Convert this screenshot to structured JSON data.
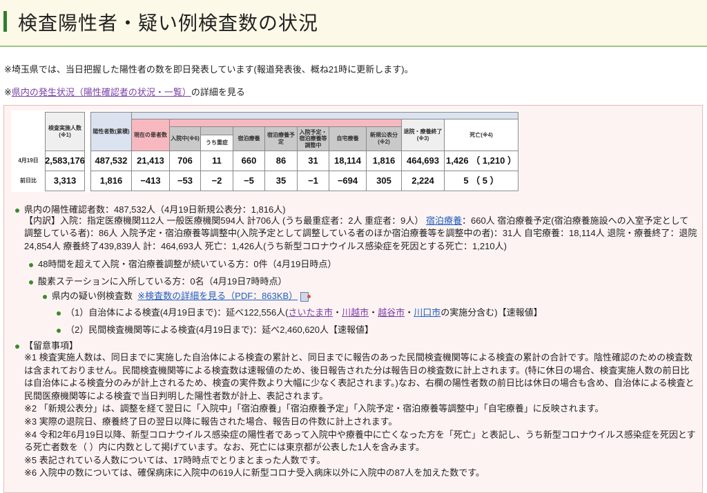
{
  "header": {
    "title": "検査陽性者・疑い例検査数の状況"
  },
  "intro": {
    "notice": "※埼玉県では、当日把握した陽性者の数を即日発表しています(報道発表後、概ね21時に更新します)。",
    "link_prefix": "※",
    "link_text": "県内の発生状況（陽性確認者の状況・一覧）",
    "link_suffix": "の詳細を見る"
  },
  "table": {
    "headers": {
      "tests": "検査実施人数(※1)",
      "positives": "陽性者数(累積)",
      "current": "現在の患者数",
      "hospitalized": "入院中(※6)",
      "severe": "うち重症",
      "hotel": "宿泊療養",
      "hotel_planned": "宿泊療養予定",
      "adjusting": "入院予定・宿泊療養等調整中",
      "home": "自宅療養",
      "new": "新規公表分(※2)",
      "recovered": "退院・療養終了(※3)",
      "deaths": "死亡(※4)"
    },
    "rows": [
      {
        "label": "4月19日",
        "tests": "2,583,176",
        "positives": "487,532",
        "current": "21,413",
        "hospitalized": "706",
        "severe": "11",
        "hotel": "660",
        "hotel_planned": "86",
        "adjusting": "31",
        "home": "18,114",
        "new": "1,816",
        "recovered": "464,693",
        "deaths": "1,426 （ 1,210 ）"
      },
      {
        "label": "前日比",
        "tests": "3,313",
        "positives": "1,816",
        "current": "−413",
        "hospitalized": "−53",
        "severe": "−2",
        "hotel": "−5",
        "hotel_planned": "35",
        "adjusting": "−1",
        "home": "−694",
        "new": "305",
        "recovered": "2,224",
        "deaths": "5 （ 5 ）"
      }
    ]
  },
  "summary": {
    "positives": "県内の陽性確認者数：487,532人（4月19日新規公表分：1,816人)",
    "breakdown_a": "【内訳】入院：指定医療機関112人 一般医療機関594人 計706人 (うち最重症者：2人 重症者：9人） ",
    "breakdown_link": "宿泊療養",
    "breakdown_b": "：660人 宿泊療養予定(宿泊療養施設への入室予定として調整している者)：86人 入院予定・宿泊療養等調整中(入院予定として調整している者のほか宿泊療養等を調整中の者)：31人 自宅療養：18,114人 退院・療養終了：退院24,854人 療養終了439,839人 計：464,693人 死亡：1,426人(うち新型コロナウイルス感染症を死因とする死亡：1,210人)",
    "over48": "48時間を超えて入院・宿泊療養調整が続いている方：0件（4月19日時点）",
    "oxygen": "酸素ステーションに入所している方：0名（4月19日7時時点）",
    "suspected_label": "県内の疑い例検査数",
    "suspected_link": "※検査数の詳細を見る（PDF：863KB）",
    "local_a": "（1）自治体による検査(4月19日まで)：延べ122,556人(",
    "city1": "さいたま市",
    "city2": "川越市",
    "city3": "越谷市",
    "city4": "川口市",
    "sep": "・",
    "local_b": "の実施分含む)【速報値】",
    "private": "（2）民間検査機関等による検査(4月19日まで)：延べ2,460,620人【速報値】"
  },
  "notes": {
    "title": "【留意事項】",
    "items": [
      "※1 検査実施人数は、同日までに実施した自治体による検査の累計と、同日までに報告のあった民間検査機関等による検査の累計の合計です。陰性確認のための検査数は含まれておりません。民間検査機関等による検査数は速報値のため、後日報告された分は報告日の検査数に計上されます。(特に休日の場合、検査実施人数の前日比は自治体による検査分のみが計上されるため、検査の実件数より大幅に少なく表記されます。)なお、右欄の陽性者数の前日比は休日の場合も含め、自治体による検査と民間医療機関等による検査で当日判明した陽性者数が計上、表記されます。",
      "※2 「新規公表分」は、調整を経て翌日に「入院中」「宿泊療養」「宿泊療養予定」「入院予定・宿泊療養等調整中」「自宅療養」に反映されます。",
      "※3 実際の退院日、療養終了日の翌日以降に報告された場合、報告日の件数に計上されます。",
      "※4 令和2年6月19日以降、新型コロナウイルス感染症の陽性者であって入院中や療養中に亡くなった方を「死亡」と表記し、うち新型コロナウイルス感染症を死因とする死亡者数を（ ）内に内数として掲げています。なお、死亡には東京都が公表した1人を含みます。",
      "※5 表記されている人数については、17時時点でとりまとまった人数です。",
      "※6 入院中の数については、確保病床に入院中の619人に新型コロナ受入病床以外に入院中の87人を加えた数です。"
    ]
  },
  "colors": {
    "accent_green": "#2f7d32",
    "link": "#1f5fbf",
    "visited_link": "#7a3fa8",
    "box_bg": "#fef3f3"
  }
}
